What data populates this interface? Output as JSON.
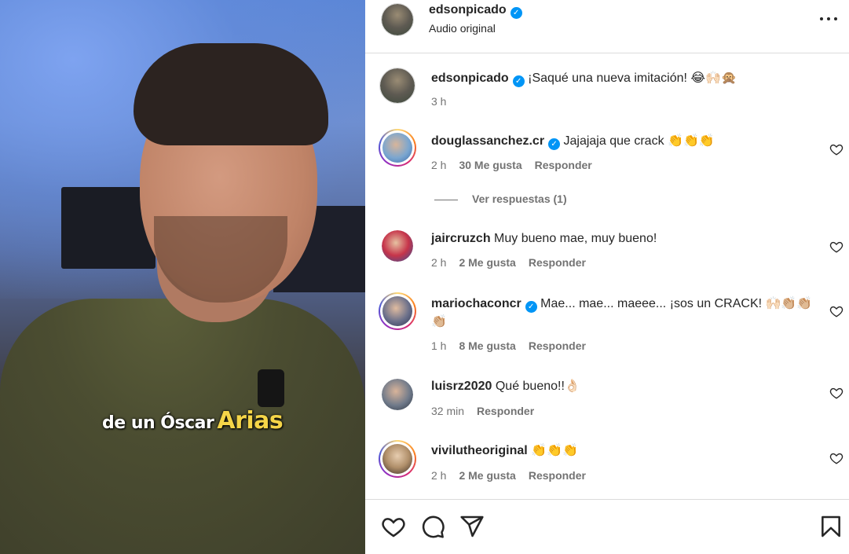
{
  "video": {
    "caption_small": "de un Óscar",
    "caption_big": "Arias"
  },
  "header": {
    "username": "edsonpicado",
    "subtitle": "Audio original",
    "more_label": "•••"
  },
  "post": {
    "username": "edsonpicado",
    "caption": "¡Saqué una nueva imitación! 😂🙌🏻🙊",
    "time": "3 h"
  },
  "comments": [
    {
      "username": "douglassanchez.cr",
      "verified": true,
      "text": "Jajajaja que crack 👏👏👏",
      "time": "2 h",
      "likes": "30 Me gusta",
      "reply": "Responder"
    },
    {
      "username": "jaircruzch",
      "verified": false,
      "text": "Muy bueno mae, muy bueno!",
      "time": "2 h",
      "likes": "2 Me gusta",
      "reply": "Responder"
    },
    {
      "username": "mariochaconcr",
      "verified": true,
      "text": "Mae... mae... maeee... ¡sos un CRACK! 🙌🏻👏🏼👏🏼👏🏼",
      "time": "1 h",
      "likes": "8 Me gusta",
      "reply": "Responder"
    },
    {
      "username": "luisrz2020",
      "verified": false,
      "text": "Qué bueno!!👌🏻",
      "time": "32 min",
      "likes": "",
      "reply": "Responder"
    },
    {
      "username": "viviluthe​original",
      "verified": false,
      "text": "👏👏👏",
      "time": "2 h",
      "likes": "2 Me gusta",
      "reply": "Responder"
    }
  ],
  "view_replies": "Ver respuestas (1)",
  "colors": {
    "verified": "#0095f6",
    "muted_text": "#737373",
    "border": "#dbdbdb"
  },
  "icons": [
    "heart-icon",
    "comment-icon",
    "share-icon",
    "bookmark-icon",
    "more-icon",
    "verified-badge-icon"
  ]
}
